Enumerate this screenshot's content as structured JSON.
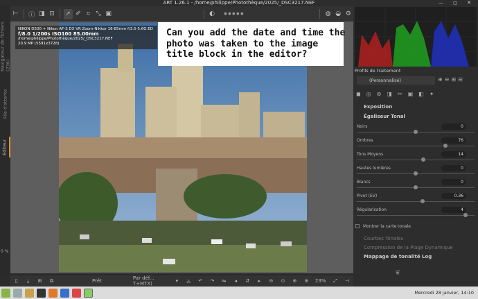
{
  "window": {
    "title": "ART 1.26.1 - /home/philippe/Photothèque/2025/_DSC3217.NEF",
    "controls": "— ◻ ✕"
  },
  "left_tabs": {
    "browser": "Navigateur de fichiers (236)",
    "queue": "File d'attente",
    "editor": "Éditeur"
  },
  "zoom_percent_left": "0 %",
  "toolbar": {
    "edit_icon": "✎",
    "crop_icon": "⬚",
    "color_dots": "● ● ● ● ●"
  },
  "question": "Can you add the date and time the photo was taken to the image title block in the editor?",
  "info_overlay": {
    "line1": "NIKON D500 + Nikon AF-S DX VR Zoom-Nikkor 16-85mm f/3.5-5.6G ED",
    "line2": "f/8.0 1/200s ISO100 85.00mm",
    "line3": "/home/philippe/Photothèque/2025/_DSC3217.NEF",
    "line4": "20.9 MP (5591x3728)"
  },
  "bottom": {
    "status": "Prêt",
    "profile": "Par déf... T+MTX)",
    "zoom": "23%"
  },
  "right_panel": {
    "profiles_label": "Profils de traitement",
    "profile_value": "(Personnalisé)",
    "sections": {
      "exposure": "Exposition",
      "tonal_eq": "Égaliseur Tonal",
      "curves": "Courbes Tonales",
      "dr_compression": "Compression de la Plage Dynamique",
      "log_tonemap": "Mappage de tonalité Log"
    },
    "sliders": [
      {
        "label": "Noirs",
        "value": "0",
        "level": 0.5
      },
      {
        "label": "Ombres",
        "value": "76",
        "level": 0.76
      },
      {
        "label": "Tons Moyens",
        "value": "14",
        "level": 0.57
      },
      {
        "label": "Hautes lumières",
        "value": "0",
        "level": 0.5
      },
      {
        "label": "Blancs",
        "value": "0",
        "level": 0.5
      },
      {
        "label": "Pivot (EV)",
        "value": "0.36",
        "level": 0.56
      },
      {
        "label": "Régularisation",
        "value": "4",
        "level": 0.94
      }
    ],
    "show_map_label": "Montrer la carte tonale"
  },
  "taskbar": {
    "datetime": "Mercredi 28 janvier, 14:10"
  }
}
